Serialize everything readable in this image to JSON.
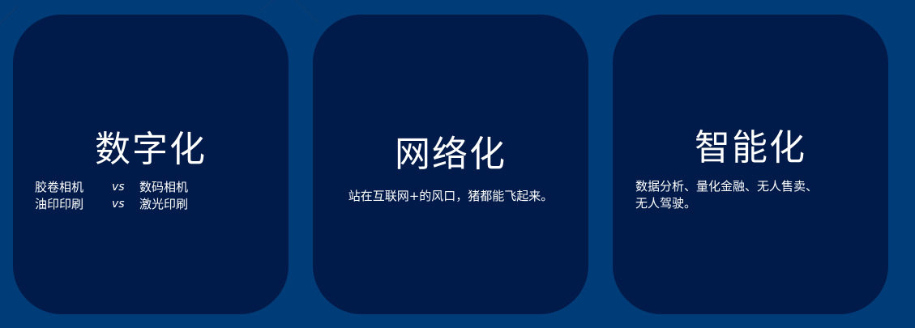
{
  "cards": [
    {
      "title": "数字化",
      "comparisons": [
        {
          "left": "胶卷相机",
          "vs": "vs",
          "right": "数码相机"
        },
        {
          "left": "油印印刷",
          "vs": "vs",
          "right": "激光印刷"
        }
      ]
    },
    {
      "title": "网络化",
      "description": "站在互联网+的风口，猪都能飞起来。"
    },
    {
      "title": "智能化",
      "description_lines": [
        "数据分析、量化金融、无人售卖、",
        "无人驾驶。"
      ]
    }
  ],
  "colors": {
    "background": "#003c77",
    "card": "#001a4a",
    "text": "#ffffff"
  }
}
